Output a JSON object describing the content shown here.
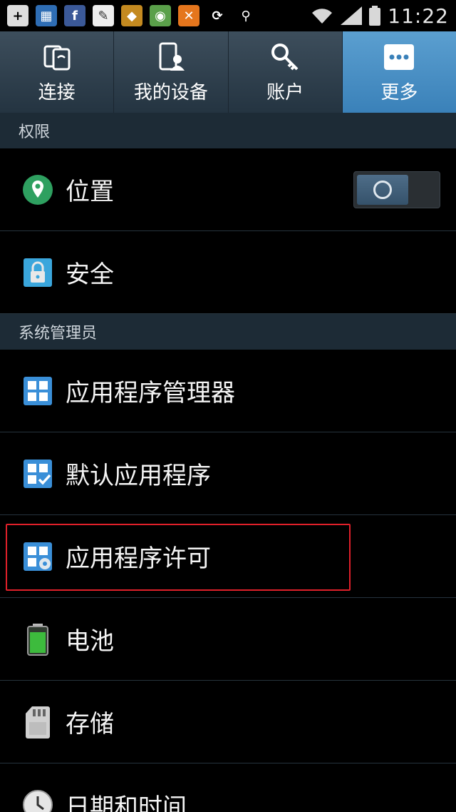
{
  "status_bar": {
    "time": "11:22",
    "icons": [
      "add-icon",
      "grid-icon",
      "facebook-icon",
      "document-icon",
      "game-icon",
      "browser-icon",
      "tool-icon",
      "sync-icon",
      "usb-icon",
      "wifi-icon",
      "signal-icon",
      "battery-icon"
    ]
  },
  "tabs": [
    {
      "label": "连接",
      "icon": "connect-icon",
      "active": false
    },
    {
      "label": "我的设备",
      "icon": "device-icon",
      "active": false
    },
    {
      "label": "账户",
      "icon": "key-icon",
      "active": false
    },
    {
      "label": "更多",
      "icon": "more-icon",
      "active": true
    }
  ],
  "sections": [
    {
      "title": "权限"
    },
    {
      "title": "系统管理员"
    }
  ],
  "items": [
    {
      "label": "位置",
      "icon": "location-icon",
      "toggle": true
    },
    {
      "label": "安全",
      "icon": "lock-icon"
    },
    {
      "label": "应用程序管理器",
      "icon": "app-manager-icon"
    },
    {
      "label": "默认应用程序",
      "icon": "default-apps-icon"
    },
    {
      "label": "应用程序许可",
      "icon": "app-permission-icon",
      "highlighted": true
    },
    {
      "label": "电池",
      "icon": "battery-icon"
    },
    {
      "label": "存储",
      "icon": "storage-icon"
    },
    {
      "label": "日期和时间",
      "icon": "clock-icon"
    }
  ],
  "colors": {
    "accent": "#3a81b9",
    "highlight_border": "#e0202a",
    "section_bg": "#1d2b36"
  }
}
